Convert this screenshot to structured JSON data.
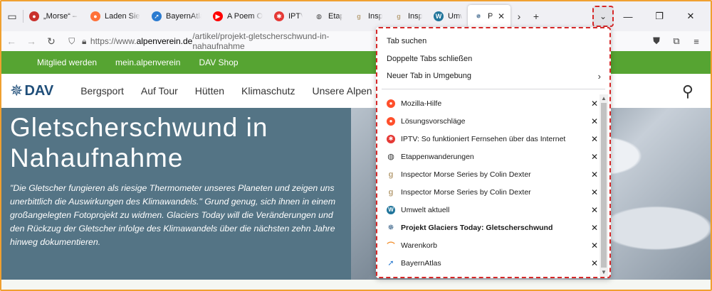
{
  "browser": {
    "tabs": [
      {
        "label": "„Morse“ – Bi",
        "icon": "opera-like-icon",
        "color": "#c9302c"
      },
      {
        "label": "Laden Sie Fi",
        "icon": "firefox-icon",
        "color": "#ff7139"
      },
      {
        "label": "BayernAtlas",
        "icon": "bayernatlas-icon",
        "color": "#2b7bd0"
      },
      {
        "label": "A Poem On",
        "icon": "youtube-icon",
        "color": "#ff0000"
      },
      {
        "label": "IPTV",
        "icon": "iptv-icon",
        "color": "#e53935"
      },
      {
        "label": "Etappen",
        "icon": "globe-icon",
        "color": "#444444"
      },
      {
        "label": "Inspec",
        "icon": "goodreads-icon",
        "color": "#b9a27a"
      },
      {
        "label": "Inspe",
        "icon": "goodreads-icon",
        "color": "#b9a27a"
      },
      {
        "label": "Umwel",
        "icon": "wordpress-icon",
        "color": "#21759b"
      },
      {
        "label": "Proj",
        "icon": "dav-icon",
        "color": "#1f4e79",
        "active": true
      }
    ],
    "url": {
      "prefix": "https://www.",
      "host": "alpenverein.de",
      "path": "/artikel/projekt-gletscherschwund-in-nahaufnahme"
    }
  },
  "page": {
    "topbar": [
      "Mitglied werden",
      "mein.alpenverein",
      "DAV Shop"
    ],
    "logo_text": "DAV",
    "menu": [
      "Bergsport",
      "Auf Tour",
      "Hütten",
      "Klimaschutz",
      "Unsere Alpen"
    ],
    "hero_title": "Gletscherschwund in Nahaufnahme",
    "hero_text": "\"Die Gletscher fungieren als riesige Thermometer unseres Planeten und zeigen uns unerbittlich die Auswirkungen des Klimawandels.\" Grund genug, sich ihnen in einem großangelegten Fotoprojekt zu widmen. Glaciers Today will die Veränderungen und den Rückzug der Gletscher infolge des Klimawandels über die nächsten zehn Jahre hinweg dokumentieren."
  },
  "panel": {
    "actions": [
      "Tab suchen",
      "Doppelte Tabs schließen",
      "Neuer Tab in Umgebung"
    ],
    "tabs": [
      {
        "label": "Mozilla-Hilfe",
        "icon": "firefox-icon",
        "color": "#ff4f2b",
        "bold": false
      },
      {
        "label": "Lösungsvorschläge",
        "icon": "firefox-icon",
        "color": "#ff4f2b",
        "bold": false
      },
      {
        "label": "IPTV: So funktioniert Fernsehen über das Internet",
        "icon": "iptv-icon",
        "color": "#e53935",
        "bold": false
      },
      {
        "label": "Etappenwanderungen",
        "icon": "globe-icon",
        "color": "#333333",
        "bold": false
      },
      {
        "label": "Inspector Morse Series by Colin Dexter",
        "icon": "goodreads-icon",
        "color": "#b9a27a",
        "bold": false
      },
      {
        "label": "Inspector Morse Series by Colin Dexter",
        "icon": "goodreads-icon",
        "color": "#b9a27a",
        "bold": false
      },
      {
        "label": "Umwelt aktuell",
        "icon": "wordpress-icon",
        "color": "#21759b",
        "bold": false
      },
      {
        "label": "Projekt Glaciers Today: Gletscherschwund",
        "icon": "dav-icon",
        "color": "#1f4e79",
        "bold": true
      },
      {
        "label": "Warenkorb",
        "icon": "cart-icon",
        "color": "#f28c28",
        "bold": false
      },
      {
        "label": "BayernAtlas",
        "icon": "bayernatlas-icon",
        "color": "#2b7bd0",
        "bold": false
      }
    ]
  }
}
